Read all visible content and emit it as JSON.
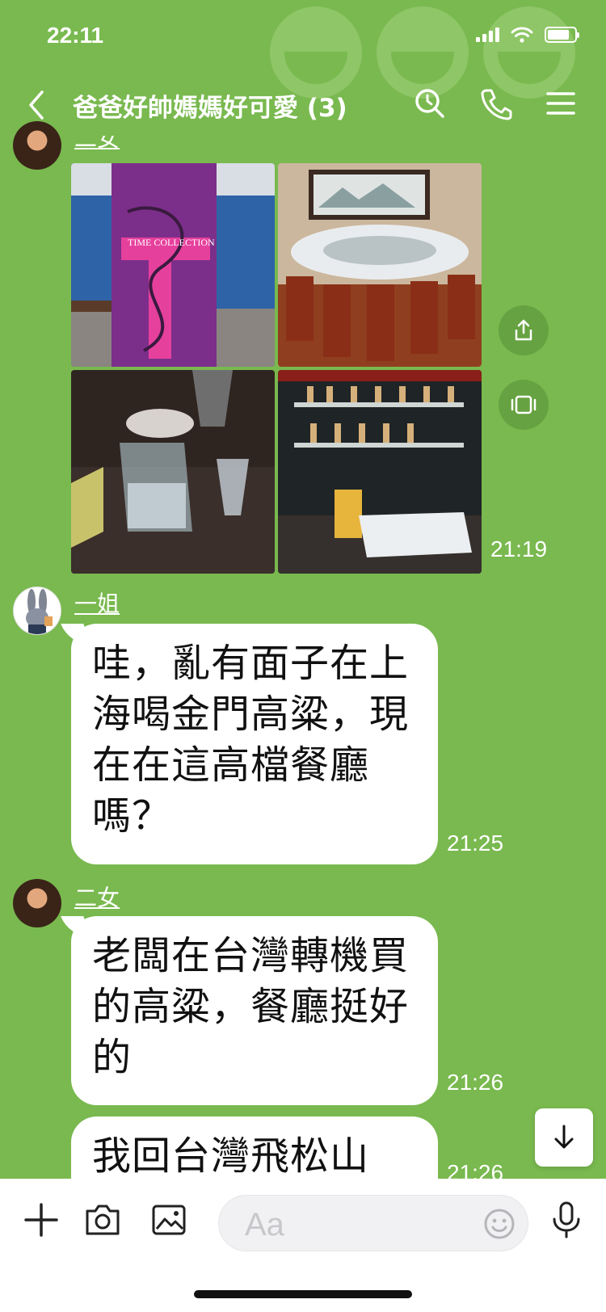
{
  "status": {
    "time": "22:11"
  },
  "chat": {
    "title": "爸爸好帥媽媽好可愛 (3)"
  },
  "messages": [
    {
      "sender": "二女",
      "type": "photos",
      "time": "21:19"
    },
    {
      "sender": "一姐",
      "text": "哇，亂有面子在上海喝金門高粱，現在在這高檔餐廳嗎？",
      "time": "21:25"
    },
    {
      "sender": "二女",
      "text": "老闆在台灣轉機買的高粱，餐廳挺好的",
      "time": "21:26"
    },
    {
      "sender": "",
      "text": "我回台灣飛松山",
      "time": "21:26"
    }
  ],
  "photo_labels": {
    "box": "TIME COLLECTION"
  },
  "input": {
    "placeholder": "Aa"
  },
  "colors": {
    "background": "#79b94f",
    "bubble": "#ffffff"
  }
}
